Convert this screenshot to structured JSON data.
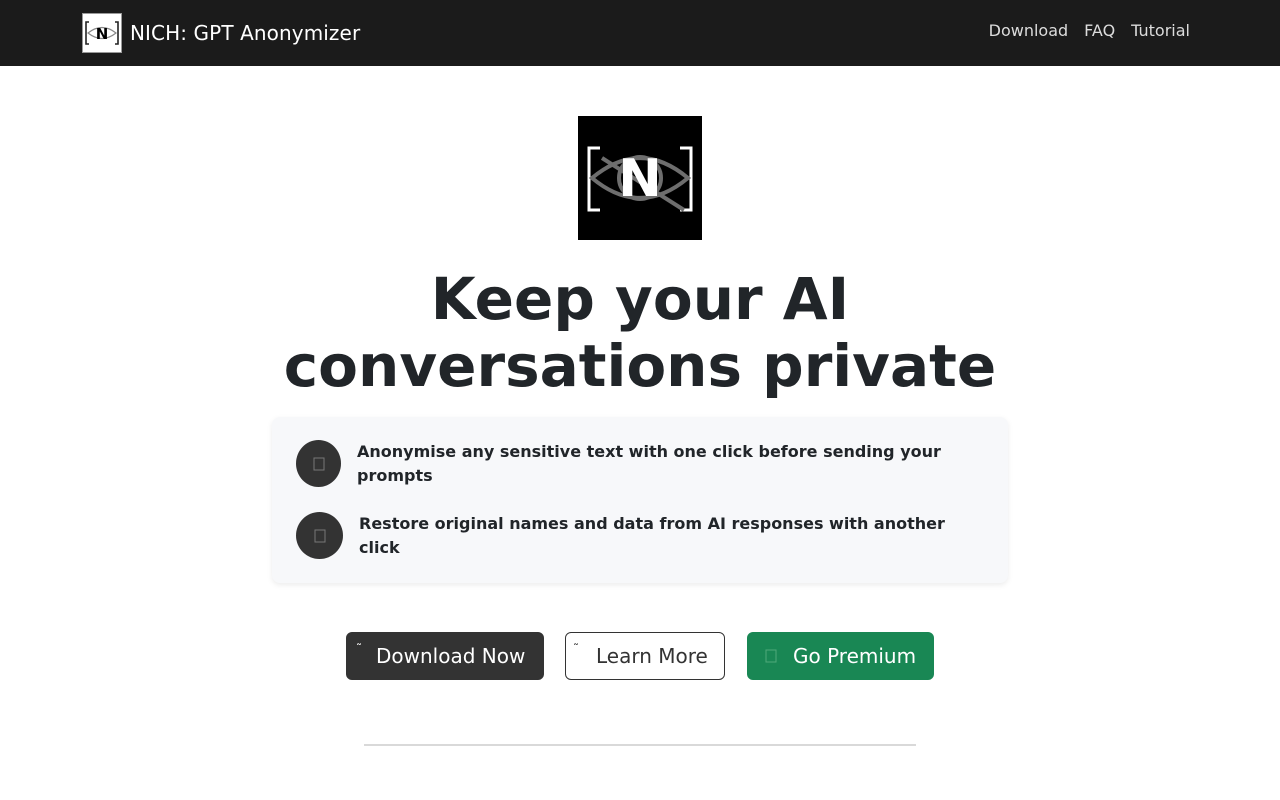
{
  "navbar": {
    "brand_title": "NICH: GPT Anonymizer",
    "brand_logo_letter": "N",
    "links": [
      {
        "label": "Download"
      },
      {
        "label": "FAQ"
      },
      {
        "label": "Tutorial"
      }
    ]
  },
  "hero": {
    "logo_letter": "N",
    "headline_line1": "Keep your AI",
    "headline_line2": "conversations private"
  },
  "features": [
    {
      "icon": "shield-icon",
      "text": "Anonymise any sensitive text with one click before sending your prompts"
    },
    {
      "icon": "undo-icon",
      "text": "Restore original names and data from AI responses with another click"
    }
  ],
  "buttons": {
    "download": {
      "label": "Download Now",
      "icon": "download-icon"
    },
    "learn": {
      "label": "Learn More",
      "icon": "info-icon"
    },
    "premium": {
      "label": "Go Premium",
      "icon": "star-icon"
    }
  },
  "colors": {
    "navbar_bg": "#1b1b1b",
    "dark_button": "#333333",
    "premium_green": "#198754",
    "feature_panel": "#f7f8fa"
  }
}
